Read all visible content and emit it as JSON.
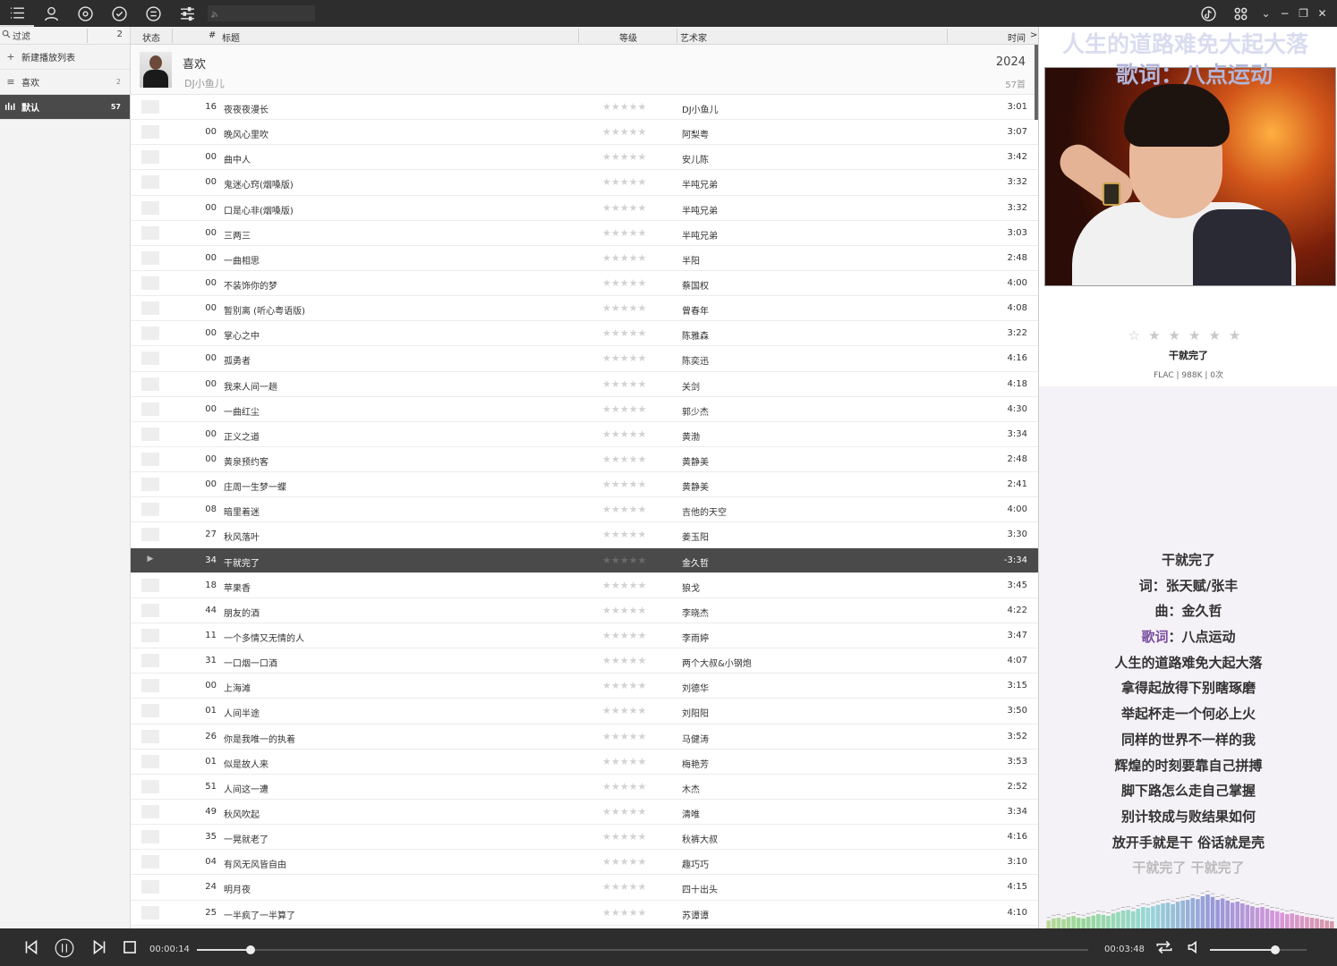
{
  "toolbar": {
    "icons": [
      "list-icon",
      "user-icon",
      "disc-icon",
      "clock-icon",
      "menu-icon",
      "settings-icon",
      "rss-icon"
    ],
    "right_icons": [
      "tiktok-icon",
      "apps-icon"
    ],
    "window": {
      "collapse": "⌄",
      "minimize": "−",
      "restore": "❐",
      "close": "✕"
    }
  },
  "sidebar": {
    "filter_label": "过滤",
    "filter_count": "2",
    "items": [
      {
        "icon": "+",
        "label": "新建播放列表",
        "count": ""
      },
      {
        "icon": "≡",
        "label": "喜欢",
        "count": "2"
      },
      {
        "icon": "▮",
        "label": "默认",
        "count": "57"
      }
    ]
  },
  "tracklist": {
    "headers": {
      "status": "状态",
      "num": "#",
      "title": "标题",
      "rating": "等级",
      "artist": "艺术家",
      "time": "时间",
      "more": ">"
    },
    "group": {
      "title": "喜欢",
      "artist": "DJ小鱼儿",
      "year": "2024",
      "count": "57首"
    },
    "rows": [
      {
        "num": "16",
        "title": "夜夜夜漫长",
        "artist": "DJ小鱼儿",
        "time": "3:01"
      },
      {
        "num": "00",
        "title": "晚风心里吹",
        "artist": "阿梨粤",
        "time": "3:07"
      },
      {
        "num": "00",
        "title": "曲中人",
        "artist": "安儿陈",
        "time": "3:42"
      },
      {
        "num": "00",
        "title": "鬼迷心窍(烟嗓版)",
        "artist": "半吨兄弟",
        "time": "3:32"
      },
      {
        "num": "00",
        "title": "口是心非(烟嗓版)",
        "artist": "半吨兄弟",
        "time": "3:32"
      },
      {
        "num": "00",
        "title": "三两三",
        "artist": "半吨兄弟",
        "time": "3:03"
      },
      {
        "num": "00",
        "title": "一曲相思",
        "artist": "半阳",
        "time": "2:48"
      },
      {
        "num": "00",
        "title": "不装饰你的梦",
        "artist": "蔡国权",
        "time": "4:00"
      },
      {
        "num": "00",
        "title": "暂别离 (听心粤语版)",
        "artist": "曾春年",
        "time": "4:08"
      },
      {
        "num": "00",
        "title": "掌心之中",
        "artist": "陈雅森",
        "time": "3:22"
      },
      {
        "num": "00",
        "title": "孤勇者",
        "artist": "陈奕迅",
        "time": "4:16"
      },
      {
        "num": "00",
        "title": "我来人间一趟",
        "artist": "关剑",
        "time": "4:18"
      },
      {
        "num": "00",
        "title": "一曲红尘",
        "artist": "郭少杰",
        "time": "4:30"
      },
      {
        "num": "00",
        "title": "正义之道",
        "artist": "黄渤",
        "time": "3:34"
      },
      {
        "num": "00",
        "title": "黄泉预约客",
        "artist": "黄静美",
        "time": "2:48"
      },
      {
        "num": "00",
        "title": "庄周一生梦一蝶",
        "artist": "黄静美",
        "time": "2:41"
      },
      {
        "num": "08",
        "title": "暗里着迷",
        "artist": "吉他的天空",
        "time": "4:00"
      },
      {
        "num": "27",
        "title": "秋风落叶",
        "artist": "姜玉阳",
        "time": "3:30"
      },
      {
        "num": "34",
        "title": "干就完了",
        "artist": "金久哲",
        "time": "-3:34",
        "playing": true
      },
      {
        "num": "18",
        "title": "苹果香",
        "artist": "狼戈",
        "time": "3:45"
      },
      {
        "num": "44",
        "title": "朋友的酒",
        "artist": "李晓杰",
        "time": "4:22"
      },
      {
        "num": "11",
        "title": "一个多情又无情的人",
        "artist": "李雨婷",
        "time": "3:47"
      },
      {
        "num": "31",
        "title": "一口烟一口酒",
        "artist": "两个大叔&小钢炮",
        "time": "4:07"
      },
      {
        "num": "00",
        "title": "上海滩",
        "artist": "刘德华",
        "time": "3:15"
      },
      {
        "num": "01",
        "title": "人间半途",
        "artist": "刘阳阳",
        "time": "3:50"
      },
      {
        "num": "26",
        "title": "你是我唯一的执着",
        "artist": "马健涛",
        "time": "3:52"
      },
      {
        "num": "01",
        "title": "似是故人来",
        "artist": "梅艳芳",
        "time": "3:53"
      },
      {
        "num": "51",
        "title": "人间这一遭",
        "artist": "木杰",
        "time": "2:52"
      },
      {
        "num": "49",
        "title": "秋风吹起",
        "artist": "清唯",
        "time": "3:34"
      },
      {
        "num": "35",
        "title": "一晃就老了",
        "artist": "秋裤大叔",
        "time": "4:16"
      },
      {
        "num": "04",
        "title": "有风无风皆自由",
        "artist": "趣巧巧",
        "time": "3:10"
      },
      {
        "num": "24",
        "title": "明月夜",
        "artist": "四十出头",
        "time": "4:15"
      },
      {
        "num": "25",
        "title": "一半疯了一半算了",
        "artist": "苏谭谭",
        "time": "4:10"
      }
    ],
    "stars": "★★★★★",
    "playing_marker": "▶"
  },
  "now_playing": {
    "overlay_line1": "人生的道路难免大起大落",
    "overlay_line2": "歌词：八点运动",
    "rating": "☆★★★★★",
    "title": "干就完了",
    "meta": "FLAC  | 988K | 0次",
    "lyrics": [
      {
        "text": "干就完了"
      },
      {
        "text": "词：张天赋/张丰"
      },
      {
        "text": "曲：金久哲"
      },
      {
        "prefix": "歌词",
        "text": "：八点运动"
      },
      {
        "text": "人生的道路难免大起大落"
      },
      {
        "text": "拿得起放得下别瞎琢磨"
      },
      {
        "text": "举起杯走一个何必上火"
      },
      {
        "text": "同样的世界不一样的我"
      },
      {
        "text": "辉煌的时刻要靠自己拼搏"
      },
      {
        "text": "脚下路怎么走自己掌握"
      },
      {
        "text": "别计较成与败结果如何"
      },
      {
        "text": "放开手就是干 俗话就是壳"
      },
      {
        "text": "干就完了 干就完了",
        "dim": true
      }
    ],
    "spectrum_levels": [
      0.22,
      0.28,
      0.3,
      0.26,
      0.32,
      0.35,
      0.3,
      0.28,
      0.33,
      0.36,
      0.4,
      0.38,
      0.35,
      0.42,
      0.46,
      0.5,
      0.52,
      0.48,
      0.55,
      0.6,
      0.58,
      0.62,
      0.66,
      0.7,
      0.72,
      0.68,
      0.75,
      0.78,
      0.8,
      0.85,
      0.82,
      0.9,
      0.95,
      0.88,
      0.8,
      0.84,
      0.78,
      0.72,
      0.75,
      0.7,
      0.66,
      0.62,
      0.58,
      0.6,
      0.55,
      0.5,
      0.48,
      0.44,
      0.4,
      0.42,
      0.38,
      0.35,
      0.32,
      0.3,
      0.28,
      0.25,
      0.22,
      0.2
    ]
  },
  "player": {
    "elapsed": "00:00:14",
    "total": "00:03:48",
    "progress": 0.06,
    "volume": 0.68,
    "colors": {
      "bar": "#2d2d2d",
      "accent": "#7a4ea0"
    }
  }
}
